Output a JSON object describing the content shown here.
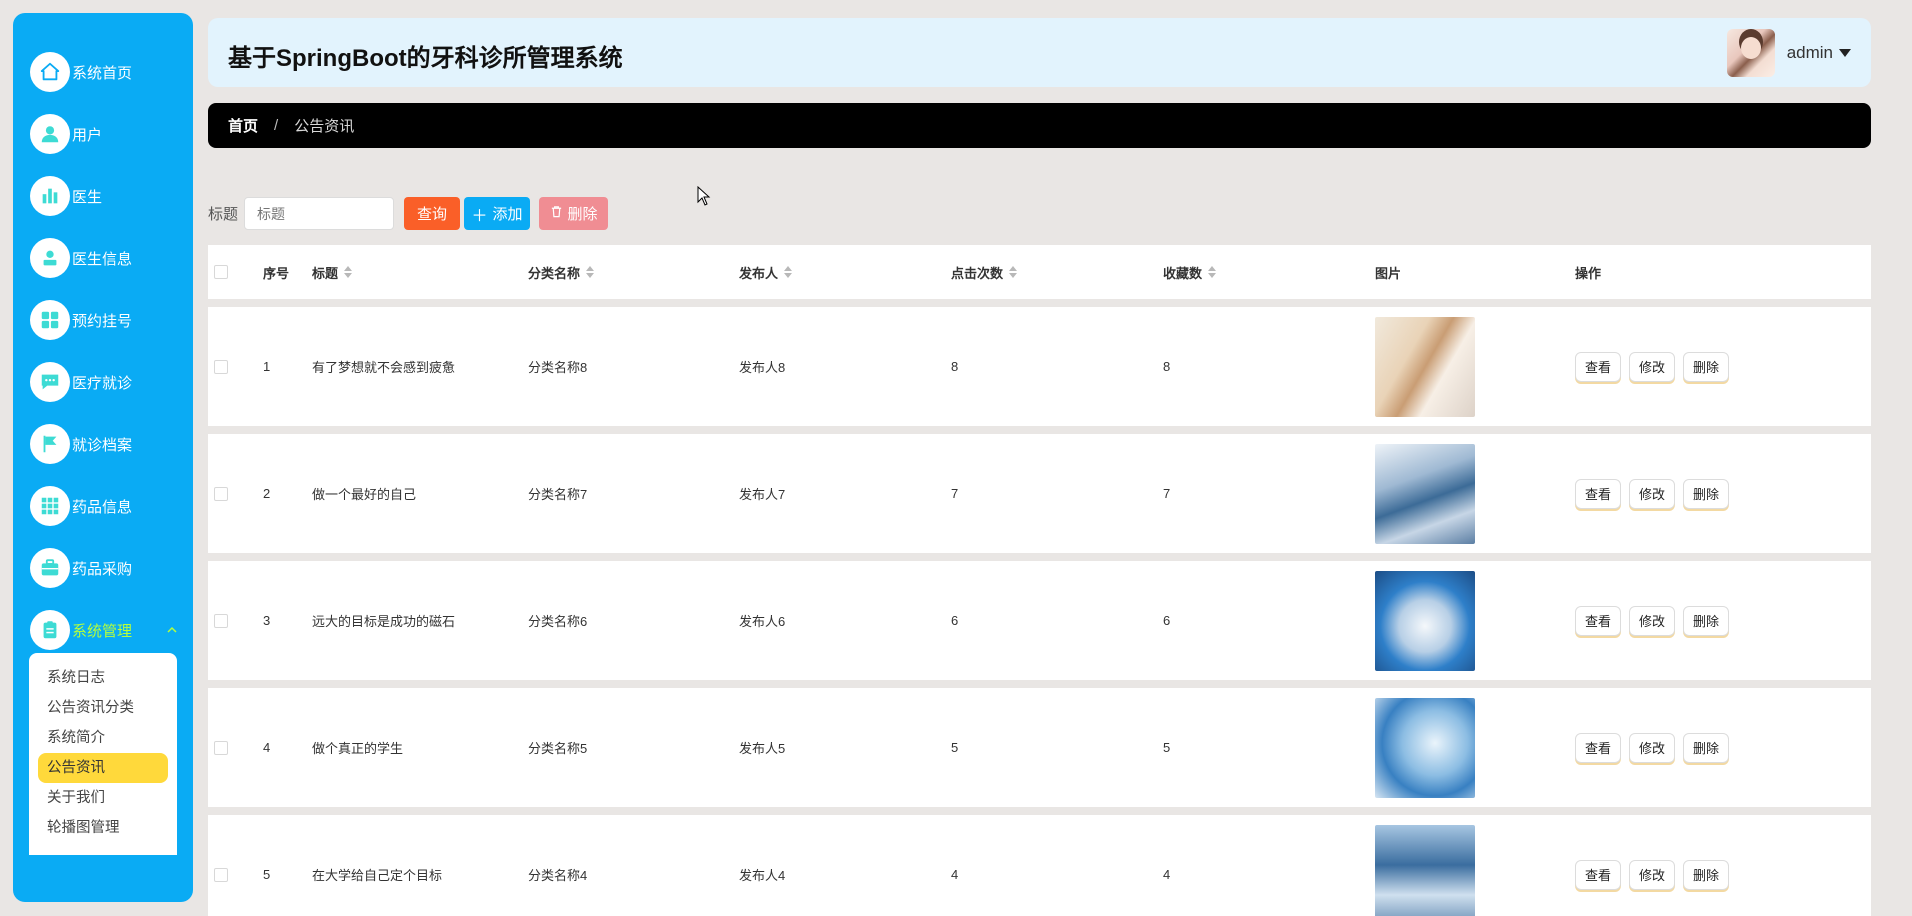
{
  "colors": {
    "sidebar_bg": "#0aabf4",
    "header_bg": "#e2f3fd",
    "breadcrumb_bg": "#000000",
    "active_menu_text": "#b6ff3b",
    "active_submenu_bg": "#ffd93b",
    "query_button": "#fa5f28",
    "add_button": "#0aabf4",
    "delete_button": "#f08d93"
  },
  "header": {
    "title": "基于SpringBoot的牙科诊所管理系统",
    "username": "admin"
  },
  "sidebar": {
    "items": [
      {
        "label": "系统首页",
        "icon": "home-icon"
      },
      {
        "label": "用户",
        "icon": "user-icon"
      },
      {
        "label": "医生",
        "icon": "bar-chart-icon"
      },
      {
        "label": "医生信息",
        "icon": "person-card-icon"
      },
      {
        "label": "预约挂号",
        "icon": "grid-icon"
      },
      {
        "label": "医疗就诊",
        "icon": "chat-icon"
      },
      {
        "label": "就诊档案",
        "icon": "flag-icon"
      },
      {
        "label": "药品信息",
        "icon": "apps-icon"
      },
      {
        "label": "药品采购",
        "icon": "briefcase-icon"
      },
      {
        "label": "系统管理",
        "icon": "clipboard-icon",
        "active": true,
        "expanded": true
      }
    ],
    "submenu": [
      {
        "label": "系统日志"
      },
      {
        "label": "公告资讯分类"
      },
      {
        "label": "系统简介"
      },
      {
        "label": "公告资讯",
        "active": true
      },
      {
        "label": "关于我们"
      },
      {
        "label": "轮播图管理"
      }
    ]
  },
  "breadcrumb": {
    "home": "首页",
    "separator": "/",
    "current": "公告资讯"
  },
  "search": {
    "label": "标题",
    "placeholder": "标题",
    "query_label": "查询",
    "add_label": "添加",
    "delete_label": "删除"
  },
  "table": {
    "columns": [
      "序号",
      "标题",
      "分类名称",
      "发布人",
      "点击次数",
      "收藏数",
      "图片",
      "操作"
    ],
    "actions": {
      "view": "查看",
      "edit": "修改",
      "delete": "删除"
    },
    "rows": [
      {
        "index": "1",
        "title": "有了梦想就不会感到疲惫",
        "category": "分类名称8",
        "publisher": "发布人8",
        "clicks": "8",
        "favorites": "8"
      },
      {
        "index": "2",
        "title": "做一个最好的自己",
        "category": "分类名称7",
        "publisher": "发布人7",
        "clicks": "7",
        "favorites": "7"
      },
      {
        "index": "3",
        "title": "远大的目标是成功的磁石",
        "category": "分类名称6",
        "publisher": "发布人6",
        "clicks": "6",
        "favorites": "6"
      },
      {
        "index": "4",
        "title": "做个真正的学生",
        "category": "分类名称5",
        "publisher": "发布人5",
        "clicks": "5",
        "favorites": "5"
      },
      {
        "index": "5",
        "title": "在大学给自己定个目标",
        "category": "分类名称4",
        "publisher": "发布人4",
        "clicks": "4",
        "favorites": "4"
      }
    ]
  }
}
